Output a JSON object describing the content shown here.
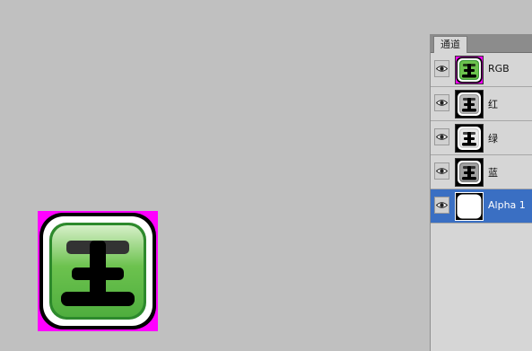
{
  "canvas": {
    "glyph": "王"
  },
  "channels_panel": {
    "tab_label": "通道",
    "channels": [
      {
        "name": "RGB",
        "visible": true,
        "selected": false,
        "thumb": "rgb"
      },
      {
        "name": "红",
        "visible": true,
        "selected": false,
        "thumb": "red"
      },
      {
        "name": "绿",
        "visible": true,
        "selected": false,
        "thumb": "green"
      },
      {
        "name": "蓝",
        "visible": true,
        "selected": false,
        "thumb": "blue"
      },
      {
        "name": "Alpha 1",
        "visible": true,
        "selected": true,
        "thumb": "alpha"
      }
    ]
  },
  "colors": {
    "canvas_bg": "#c0c0c0",
    "magenta": "#ff00ff",
    "icon_green": "#5fc04a",
    "selection_blue": "#3a6fc3"
  }
}
